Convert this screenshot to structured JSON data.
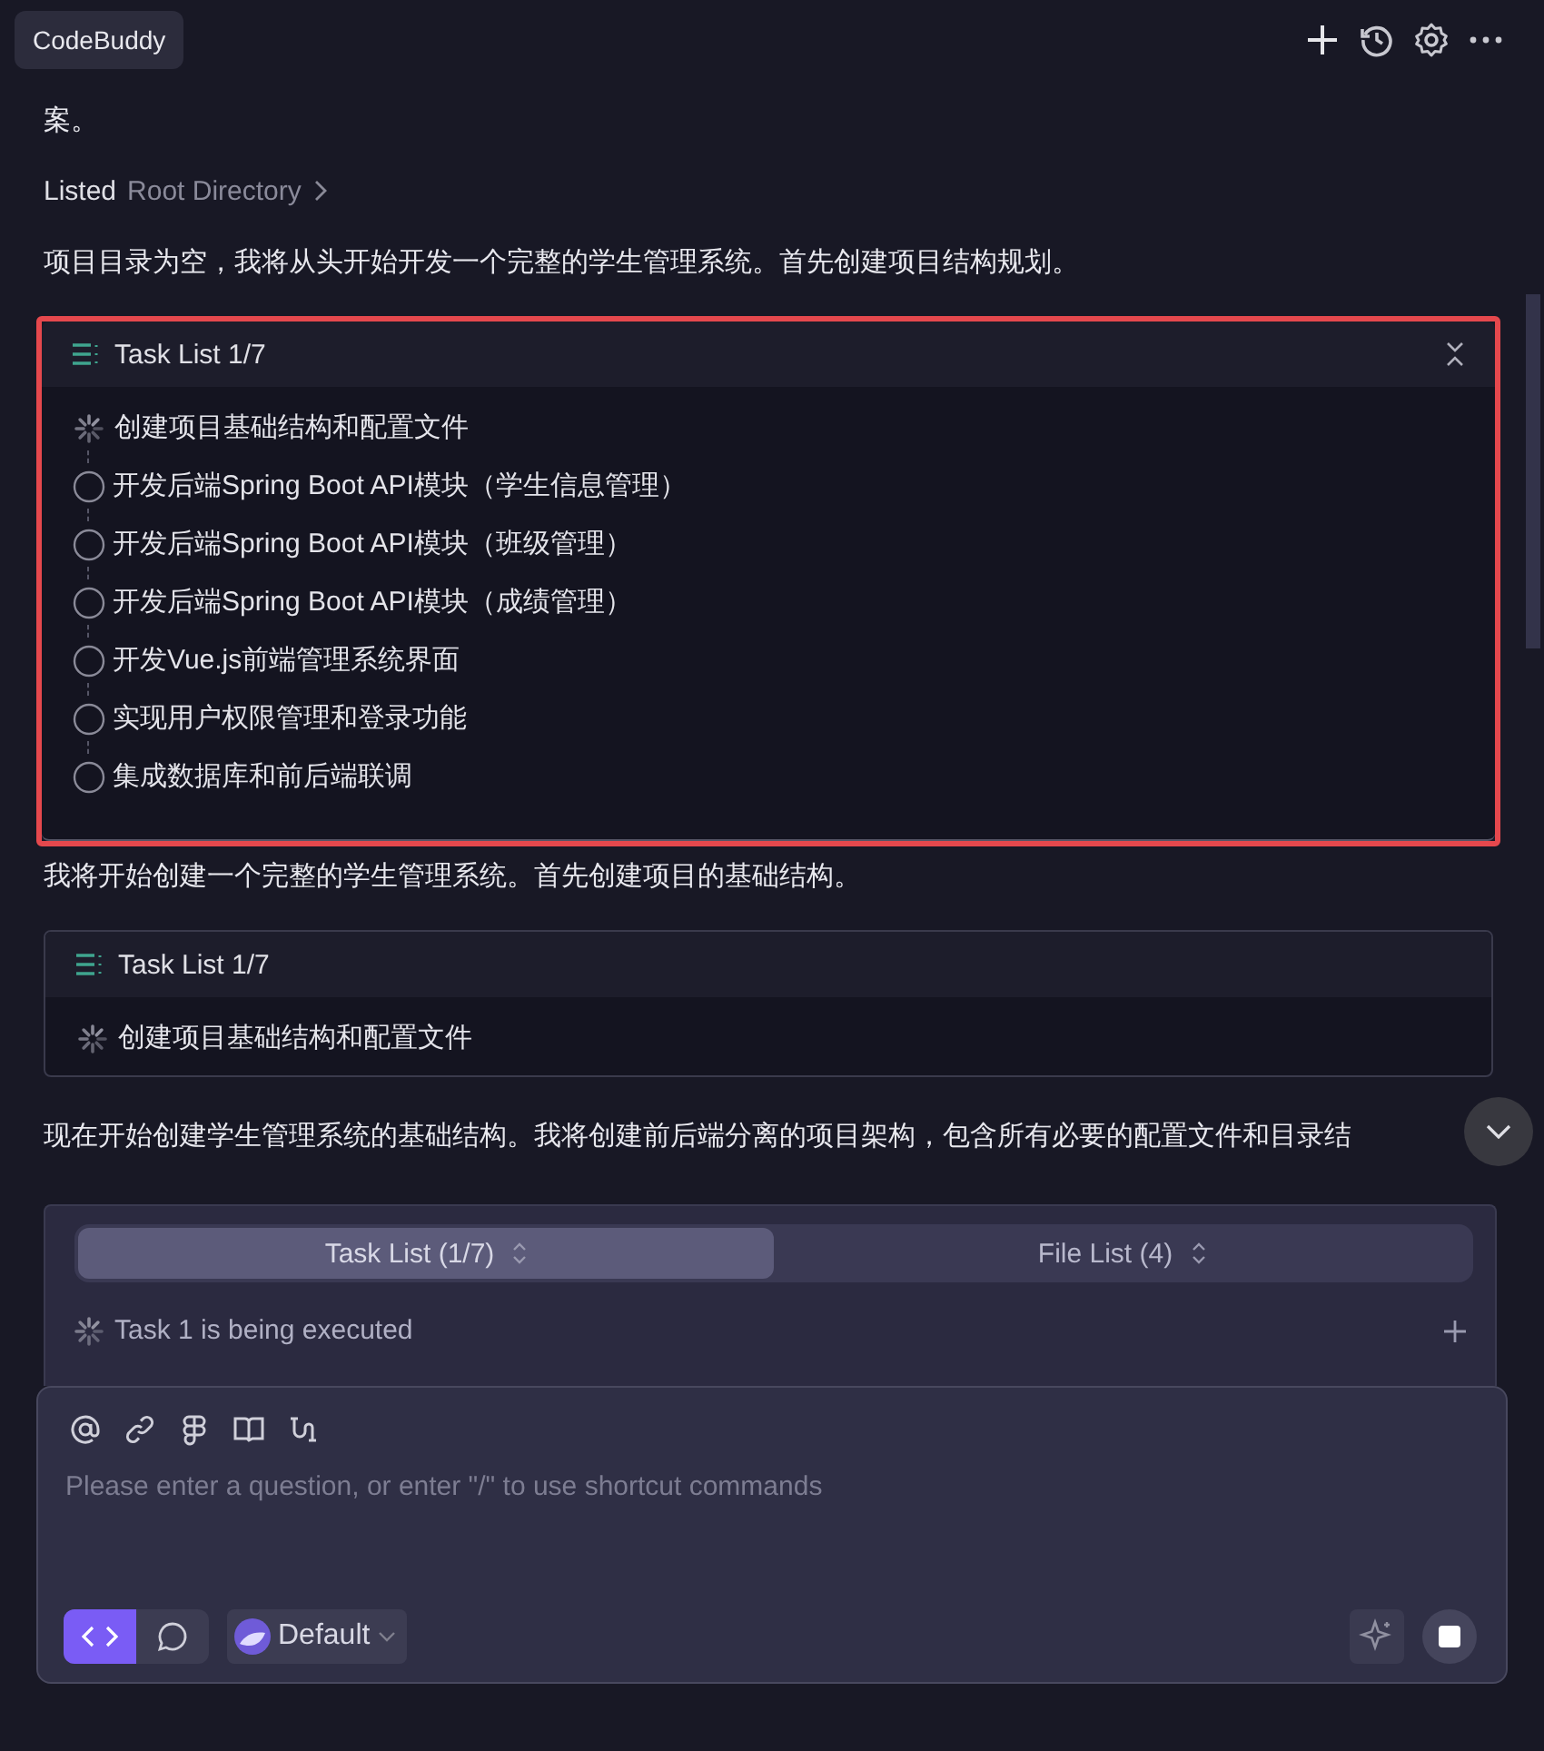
{
  "header": {
    "title": "CodeBuddy"
  },
  "messages": [
    {
      "kind": "text",
      "text": "案。"
    },
    {
      "kind": "listed",
      "action": "Listed",
      "target": "Root Directory"
    },
    {
      "kind": "text",
      "text": "项目目录为空，我将从头开始开发一个完整的学生管理系统。首先创建项目结构规划。"
    },
    {
      "kind": "tasks",
      "title": "Task List 1/7",
      "highlighted": true,
      "collapsible": true,
      "items": [
        {
          "text": "创建项目基础结构和配置文件",
          "in_progress": true
        },
        {
          "text": "开发后端Spring Boot API模块（学生信息管理）",
          "in_progress": false
        },
        {
          "text": "开发后端Spring Boot API模块（班级管理）",
          "in_progress": false
        },
        {
          "text": "开发后端Spring Boot API模块（成绩管理）",
          "in_progress": false
        },
        {
          "text": "开发Vue.js前端管理系统界面",
          "in_progress": false
        },
        {
          "text": "实现用户权限管理和登录功能",
          "in_progress": false
        },
        {
          "text": "集成数据库和前后端联调",
          "in_progress": false
        }
      ]
    },
    {
      "kind": "text",
      "text": "我将开始创建一个完整的学生管理系统。首先创建项目的基础结构。"
    },
    {
      "kind": "tasks",
      "title": "Task List 1/7",
      "highlighted": false,
      "collapsible": false,
      "items": [
        {
          "text": "创建项目基础结构和配置文件",
          "in_progress": true
        }
      ]
    },
    {
      "kind": "text",
      "text": "现在开始创建学生管理系统的基础结构。我将创建前后端分离的项目架构，包含所有必要的配置文件和目录结"
    }
  ],
  "progress_panel": {
    "tabs": [
      {
        "label": "Task List (1/7)",
        "selected": true
      },
      {
        "label": "File List (4)",
        "selected": false
      }
    ],
    "status": "Task 1 is being executed"
  },
  "composer": {
    "placeholder": "Please enter a question, or enter \"/\" to use shortcut commands",
    "modes": [
      {
        "kind": "code",
        "selected": true
      },
      {
        "kind": "chat",
        "selected": false
      }
    ],
    "model": "Default"
  }
}
